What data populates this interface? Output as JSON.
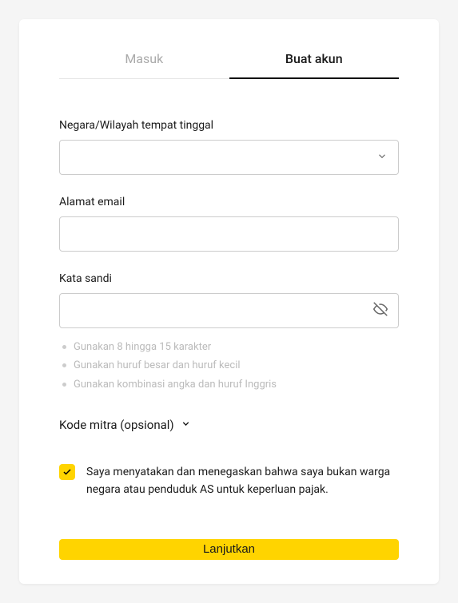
{
  "tabs": {
    "signin": "Masuk",
    "signup": "Buat akun"
  },
  "fields": {
    "country_label": "Negara/Wilayah tempat tinggal",
    "email_label": "Alamat email",
    "password_label": "Kata sandi"
  },
  "password_rules": [
    "Gunakan 8 hingga 15 karakter",
    "Gunakan huruf besar dan huruf kecil",
    "Gunakan kombinasi angka dan huruf Inggris"
  ],
  "partner_code_label": "Kode mitra (opsional)",
  "declaration_text": "Saya menyatakan dan menegaskan bahwa saya bukan warga negara atau penduduk AS untuk keperluan pajak.",
  "submit_label": "Lanjutkan",
  "colors": {
    "accent": "#ffd400"
  }
}
